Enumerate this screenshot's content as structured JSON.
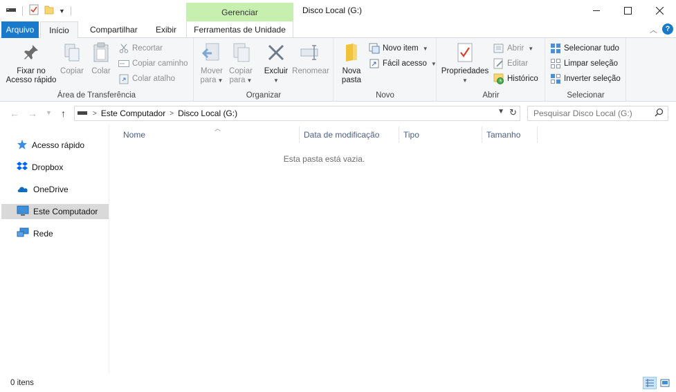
{
  "window": {
    "title": "Disco Local (G:)",
    "context_tab_header": "Gerenciar",
    "controls": {
      "minimize": "—",
      "maximize": "☐",
      "close": "✕"
    }
  },
  "tabs": [
    {
      "label": "Arquivo",
      "active": false
    },
    {
      "label": "Início",
      "active": true
    },
    {
      "label": "Compartilhar",
      "active": false
    },
    {
      "label": "Exibir",
      "active": false
    },
    {
      "label": "Ferramentas de Unidade",
      "active": false
    }
  ],
  "ribbon": {
    "clipboard": {
      "label": "Área de Transferência",
      "pin_line1": "Fixar no",
      "pin_line2": "Acesso rápido",
      "copy": "Copiar",
      "paste": "Colar",
      "cut": "Recortar",
      "copy_path": "Copiar caminho",
      "paste_shortcut": "Colar atalho"
    },
    "organize": {
      "label": "Organizar",
      "move_line1": "Mover",
      "move_line2": "para",
      "copy_line1": "Copiar",
      "copy_line2": "para",
      "delete": "Excluir",
      "rename": "Renomear"
    },
    "new": {
      "label": "Novo",
      "new_folder_line1": "Nova",
      "new_folder_line2": "pasta",
      "new_item": "Novo item",
      "easy_access": "Fácil acesso"
    },
    "open": {
      "label": "Abrir",
      "properties": "Propriedades",
      "open": "Abrir",
      "edit": "Editar",
      "history": "Histórico"
    },
    "select": {
      "label": "Selecionar",
      "select_all": "Selecionar tudo",
      "select_none": "Limpar seleção",
      "invert": "Inverter seleção"
    }
  },
  "address": {
    "crumbs": [
      "Este Computador",
      "Disco Local (G:)"
    ],
    "search_placeholder": "Pesquisar Disco Local (G:)"
  },
  "sidebar": {
    "items": [
      {
        "label": "Acesso rápido",
        "icon": "star-icon",
        "selected": false
      },
      {
        "label": "Dropbox",
        "icon": "dropbox-icon",
        "selected": false
      },
      {
        "label": "OneDrive",
        "icon": "cloud-icon",
        "selected": false
      },
      {
        "label": "Este Computador",
        "icon": "computer-icon",
        "selected": true
      },
      {
        "label": "Rede",
        "icon": "network-icon",
        "selected": false
      }
    ]
  },
  "columns": [
    "Nome",
    "Data de modificação",
    "Tipo",
    "Tamanho"
  ],
  "empty_message": "Esta pasta está vazia.",
  "status": {
    "item_count": "0 itens"
  },
  "colors": {
    "accent": "#1979ca",
    "context_tab": "#c6efb0",
    "ribbon_bg": "#f5f6f7",
    "selected_nav": "#d9d9d9",
    "column_header_text": "#4d6082"
  }
}
